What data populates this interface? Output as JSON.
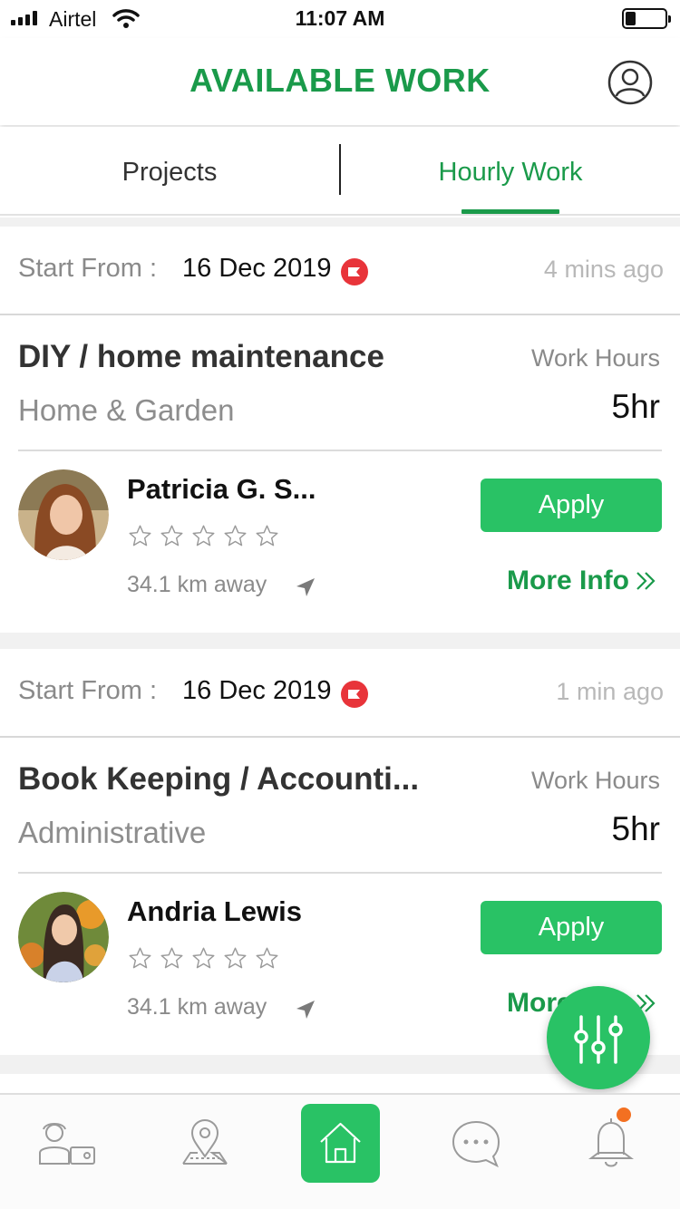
{
  "status_bar": {
    "carrier": "Airtel",
    "time": "11:07 AM",
    "signal_bars": 4,
    "battery_level": 0.25
  },
  "header": {
    "title": "AVAILABLE WORK",
    "profile_icon": "user-circle-icon"
  },
  "tabs": [
    {
      "label": "Projects",
      "active": false
    },
    {
      "label": "Hourly Work",
      "active": true
    }
  ],
  "jobs": [
    {
      "start_label": "Start From :",
      "start_date": "16 Dec 2019",
      "time_ago": "4 mins ago",
      "title": "DIY / home maintenance",
      "category": "Home & Garden",
      "hours_label": "Work Hours",
      "hours_value": "5hr",
      "owner_name": "Patricia G. S...",
      "rating": 0,
      "distance": "34.1  km away",
      "apply_label": "Apply",
      "more_label": "More Info"
    },
    {
      "start_label": "Start From :",
      "start_date": "16 Dec 2019",
      "time_ago": "1 min ago",
      "title": "Book Keeping / Accounti...",
      "category": "Administrative",
      "hours_label": "Work Hours",
      "hours_value": "5hr",
      "owner_name": "Andria Lewis",
      "rating": 0,
      "distance": "34.1  km away",
      "apply_label": "Apply",
      "more_label": "More Info"
    }
  ],
  "fab": {
    "icon": "filter-sliders-icon"
  },
  "bottom_nav": [
    {
      "icon": "worker-profile-icon",
      "active": false
    },
    {
      "icon": "map-location-icon",
      "active": false
    },
    {
      "icon": "home-icon",
      "active": true
    },
    {
      "icon": "chat-bubble-icon",
      "active": false
    },
    {
      "icon": "bell-icon",
      "active": false,
      "has_badge": true
    }
  ],
  "colors": {
    "brand_green": "#1a9a4a",
    "button_green": "#29c265",
    "badge_orange": "#f37021",
    "date_badge_red": "#e8343a"
  }
}
